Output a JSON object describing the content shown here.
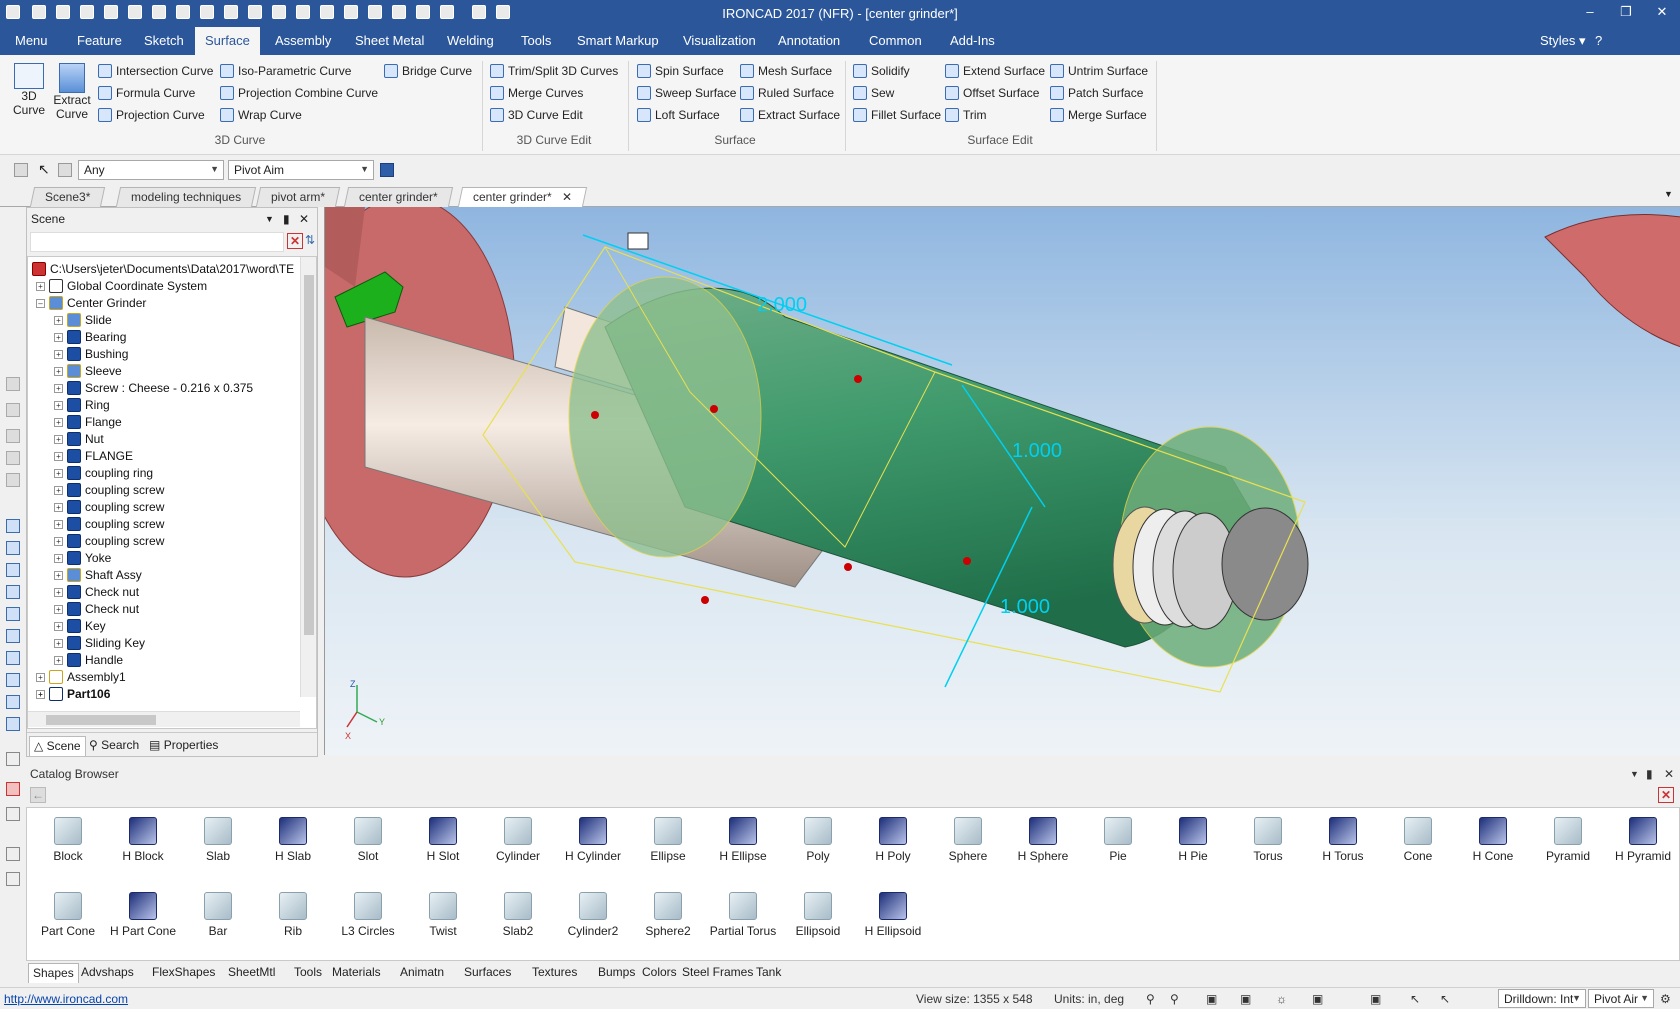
{
  "window": {
    "title": "IRONCAD 2017 (NFR) - [center grinder*]"
  },
  "menu": {
    "tabs": [
      "Menu",
      "Feature",
      "Sketch",
      "Surface",
      "Assembly",
      "Sheet Metal",
      "Welding",
      "Tools",
      "Smart Markup",
      "Visualization",
      "Annotation",
      "Common",
      "Add-Ins"
    ],
    "styles_label": "Styles"
  },
  "ribbon": {
    "big": {
      "curve3d": "3D Curve",
      "extract": "Extract Curve"
    },
    "curve_items": [
      "Intersection Curve",
      "Iso-Parametric Curve",
      "Bridge Curve",
      "Formula Curve",
      "Projection Combine Curve",
      "Projection Curve",
      "Wrap Curve"
    ],
    "edit_items": [
      "Trim/Split 3D Curves",
      "Merge Curves",
      "3D Curve Edit"
    ],
    "surface_items": [
      "Spin Surface",
      "Mesh Surface",
      "Sweep Surface",
      "Ruled Surface",
      "Loft Surface",
      "Extract Surface"
    ],
    "surfedit_items": [
      "Solidify",
      "Extend Surface",
      "Untrim Surface",
      "Sew",
      "Offset Surface",
      "Patch Surface",
      "Fillet Surface",
      "Trim",
      "Merge Surface"
    ],
    "groups": [
      "3D Curve",
      "3D Curve Edit",
      "Surface",
      "Surface Edit"
    ]
  },
  "selection": {
    "filter": "Any",
    "mode": "Pivot Aim"
  },
  "doc_tabs": [
    "Scene3*",
    "modeling techniques",
    "pivot arm*",
    "center grinder*",
    "center grinder*"
  ],
  "scene": {
    "title": "Scene",
    "path": "C:\\Users\\jeter\\Documents\\Data\\2017\\word\\TE",
    "tree": [
      "Global Coordinate System",
      "Center Grinder",
      "Slide",
      "Bearing",
      "Bushing",
      "Sleeve",
      "Screw : Cheese - 0.216 x 0.375",
      "Ring",
      "Flange",
      "Nut",
      "FLANGE",
      "coupling ring",
      "coupling screw",
      "coupling screw",
      "coupling screw",
      "coupling screw",
      "Yoke",
      "Shaft Assy",
      "Check nut",
      "Check nut",
      "Key",
      "Sliding Key",
      "Handle",
      "Assembly1",
      "Part106"
    ],
    "tabs": [
      "Scene",
      "Search",
      "Properties"
    ]
  },
  "viewport": {
    "dims": [
      "2.000",
      "1.000",
      "1.000"
    ],
    "axes": [
      "Z",
      "Y",
      "X"
    ]
  },
  "catalog": {
    "title": "Catalog Browser",
    "shapes": [
      "Block",
      "H Block",
      "Slab",
      "H Slab",
      "Slot",
      "H Slot",
      "Cylinder",
      "H Cylinder",
      "Ellipse",
      "H Ellipse",
      "Poly",
      "H Poly",
      "Sphere",
      "H Sphere",
      "Pie",
      "H Pie",
      "Torus",
      "H Torus",
      "Cone",
      "H Cone",
      "Pyramid",
      "H Pyramid",
      "Part Cone",
      "H Part Cone",
      "Bar",
      "Rib",
      "L3 Circles",
      "Twist",
      "Slab2",
      "Cylinder2",
      "Sphere2",
      "Partial Torus",
      "Ellipsoid",
      "H Ellipsoid"
    ],
    "tabs": [
      "Shapes",
      "Advshaps",
      "FlexShapes",
      "SheetMtl",
      "Tools",
      "Materials",
      "Animatn",
      "Surfaces",
      "Textures",
      "Bumps",
      "Colors",
      "Steel Frames",
      "Tank"
    ]
  },
  "status": {
    "link": "http://www.ironcad.com",
    "view_size": "View size: 1355 x  548",
    "units": "Units: in, deg",
    "drilldown": "Drilldown: Int",
    "pivot": "Pivot Air"
  },
  "colors": {
    "title_blue": "#2b579a",
    "part_green": "#3a9a6a",
    "dim_cyan": "#00d0f0"
  }
}
